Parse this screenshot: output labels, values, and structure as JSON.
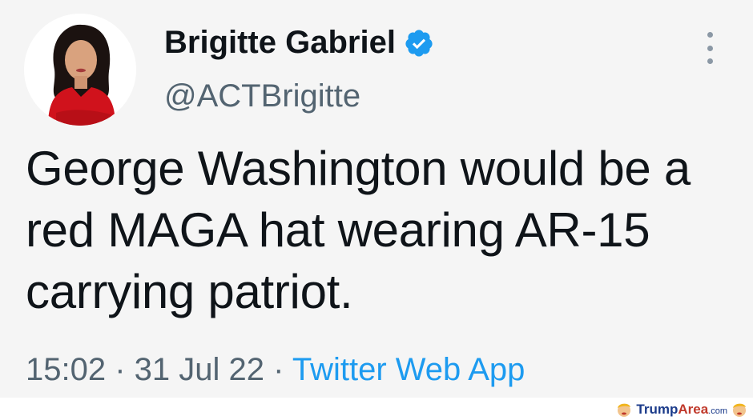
{
  "tweet": {
    "display_name": "Brigitte Gabriel",
    "handle": "@ACTBrigitte",
    "text": "George Washington would be a red MAGA hat wearing AR-15 carrying patriot.",
    "time": "15:02",
    "separator": "·",
    "date": "31 Jul 22",
    "source": "Twitter Web App",
    "verified": true,
    "verified_icon": "verified-badge-icon",
    "more_icon": "more-vertical-icon"
  },
  "watermark": {
    "trump": "Trump",
    "area": "Area",
    "dotcom": ".com",
    "logo_icon": "trump-face-icon"
  },
  "colors": {
    "background": "#f5f5f5",
    "text": "#0f1419",
    "secondary": "#536471",
    "link": "#1d9bf0",
    "verified": "#1d9bf0"
  }
}
